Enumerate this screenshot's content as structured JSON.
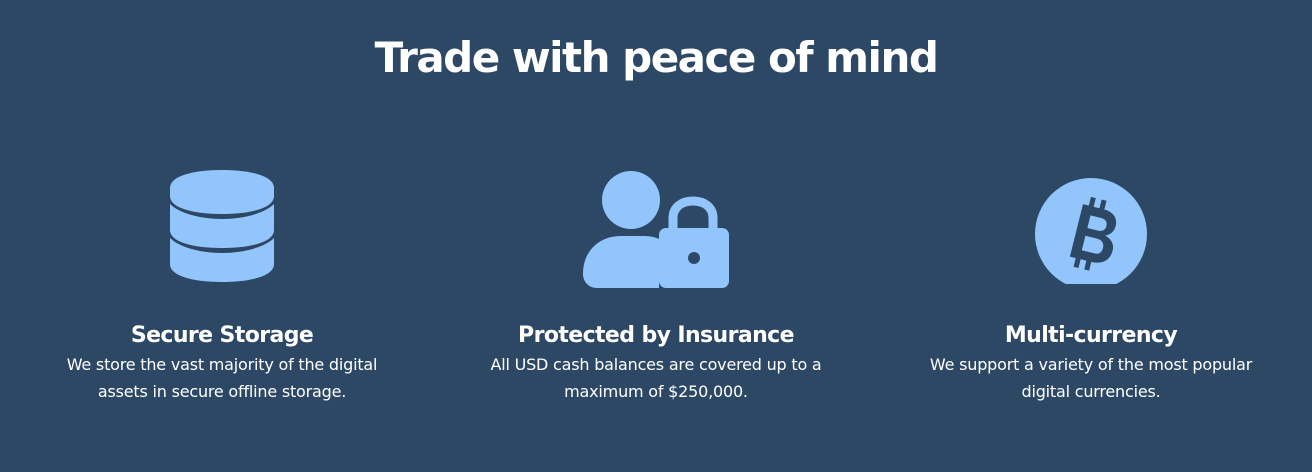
{
  "heading": "Trade with peace of mind",
  "features": [
    {
      "icon": "database-icon",
      "title": "Secure Storage",
      "description": "We store the vast majority of the digital assets in secure offline storage."
    },
    {
      "icon": "user-lock-icon",
      "title": "Protected by Insurance",
      "description": "All USD cash balances are covered up to a maximum of $250,000."
    },
    {
      "icon": "bitcoin-icon",
      "title": "Multi-currency",
      "description": "We support a variety of the most popular digital currencies."
    }
  ],
  "colors": {
    "background": "#2d4865",
    "icon": "#93c5fd",
    "text": "#ffffff"
  }
}
